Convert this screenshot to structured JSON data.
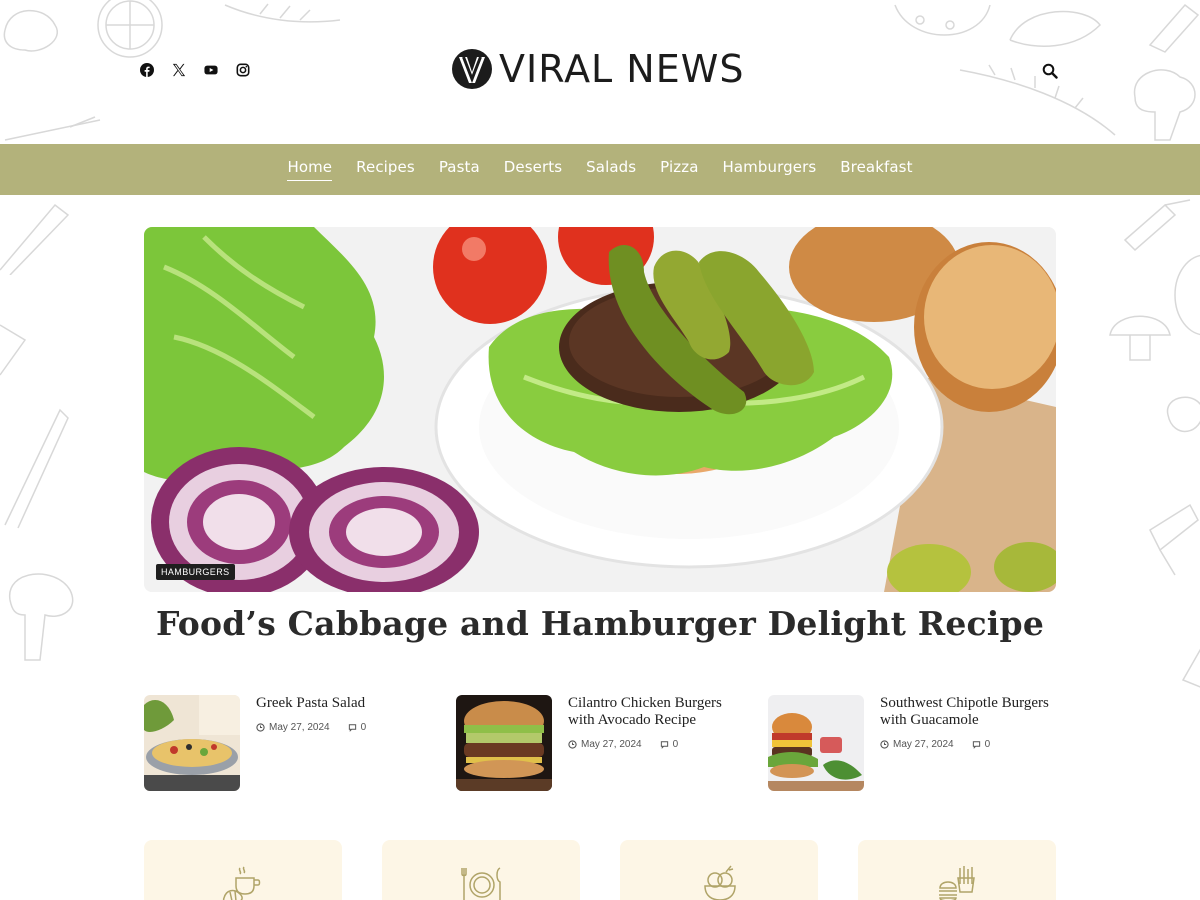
{
  "site": {
    "logo_text": "VIRAL NEWS",
    "accent_color": "#b3b27b",
    "card_color": "#fdf6e6"
  },
  "socials": [
    {
      "icon": "facebook-icon"
    },
    {
      "icon": "x-twitter-icon"
    },
    {
      "icon": "youtube-icon"
    },
    {
      "icon": "instagram-icon"
    }
  ],
  "nav": {
    "items": [
      "Home",
      "Recipes",
      "Pasta",
      "Deserts",
      "Salads",
      "Pizza",
      "Hamburgers",
      "Breakfast"
    ],
    "active": "Home"
  },
  "hero": {
    "category": "HAMBURGERS",
    "title": "Food’s Cabbage and Hamburger Delight Recipe"
  },
  "posts": [
    {
      "title": "Greek Pasta Salad",
      "date": "May 27, 2024",
      "comments": "0"
    },
    {
      "title": "Cilantro Chicken Burgers with Avocado Recipe",
      "date": "May 27, 2024",
      "comments": "0"
    },
    {
      "title": "Southwest Chipotle Burgers with Guacamole",
      "date": "May 27, 2024",
      "comments": "0"
    }
  ],
  "categories": [
    {
      "icon": "croissant-coffee-icon"
    },
    {
      "icon": "plate-cutlery-icon"
    },
    {
      "icon": "ice-cream-bowl-icon"
    },
    {
      "icon": "fries-burger-icon"
    }
  ]
}
